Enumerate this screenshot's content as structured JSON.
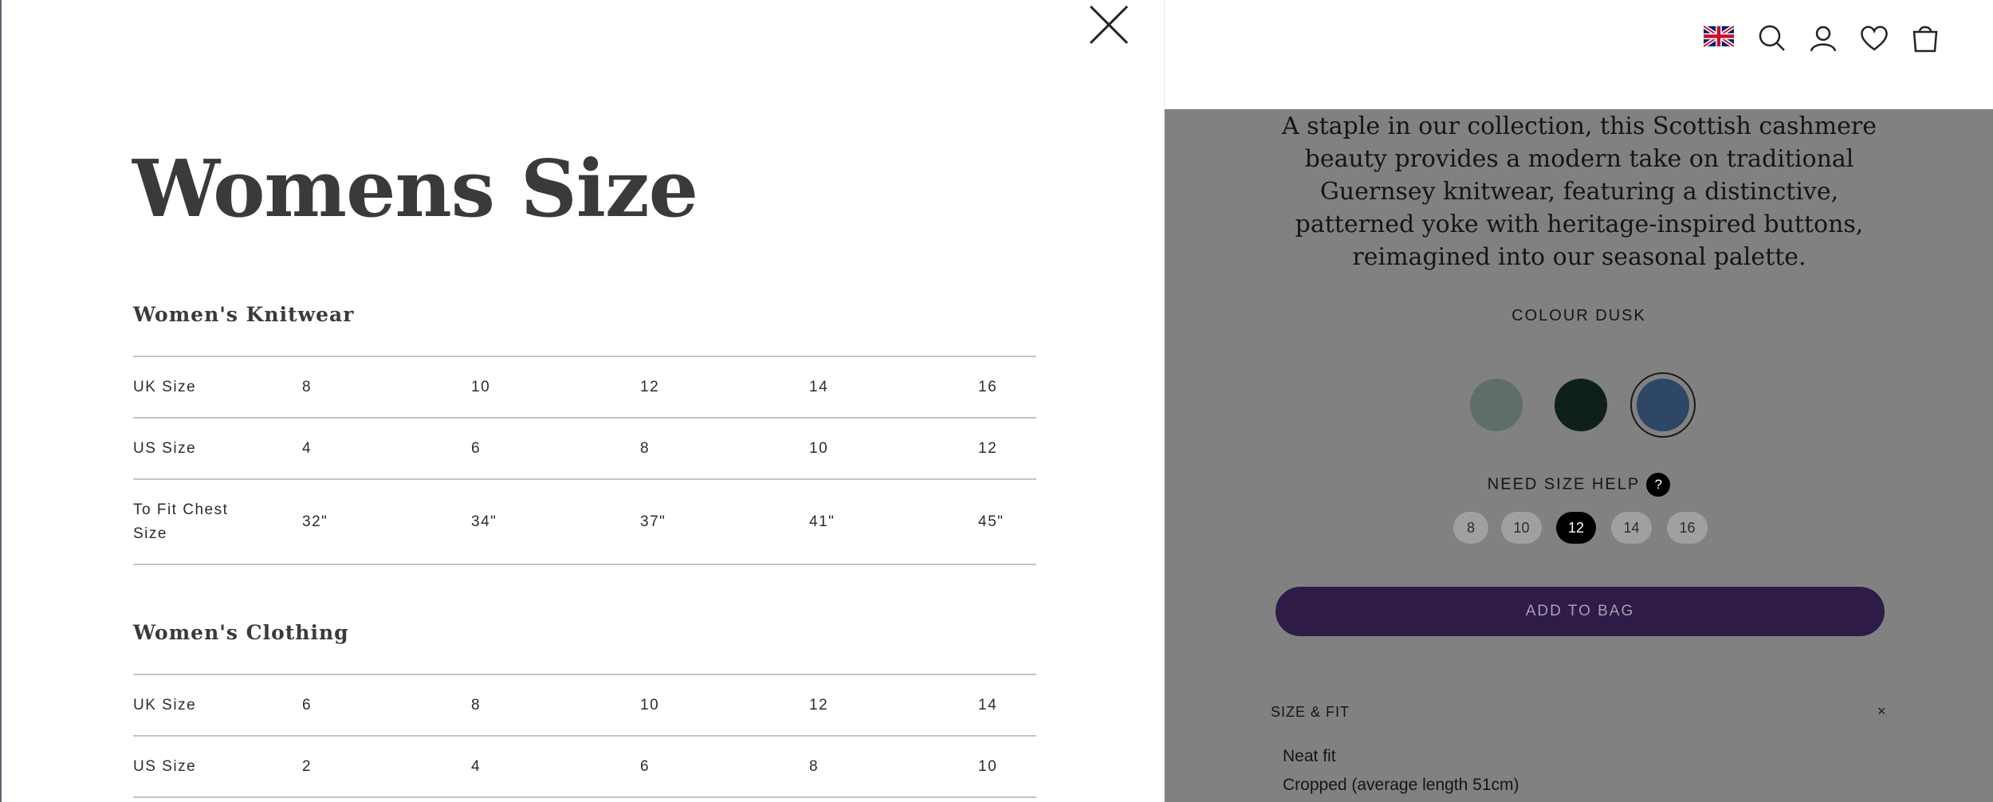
{
  "modal": {
    "title": "Womens Size",
    "close_icon": "close-x-icon",
    "sections": [
      {
        "title": "Women's Knitwear",
        "rows": [
          {
            "label": "UK Size",
            "values": [
              "8",
              "10",
              "12",
              "14",
              "16"
            ]
          },
          {
            "label": "US Size",
            "values": [
              "4",
              "6",
              "8",
              "10",
              "12"
            ]
          },
          {
            "label": "To Fit Chest Size",
            "values": [
              "32\"",
              "34\"",
              "37\"",
              "41\"",
              "45\""
            ]
          }
        ]
      },
      {
        "title": "Women's Clothing",
        "rows": [
          {
            "label": "UK Size",
            "values": [
              "6",
              "8",
              "10",
              "12",
              "14"
            ]
          },
          {
            "label": "US Size",
            "values": [
              "2",
              "4",
              "6",
              "8",
              "10"
            ]
          }
        ]
      }
    ]
  },
  "header": {
    "icons": [
      "uk-flag-icon",
      "search-icon",
      "account-icon",
      "wishlist-heart-icon",
      "shopping-bag-icon"
    ]
  },
  "product": {
    "description": "A staple in our collection, this Scottish cashmere beauty provides a modern take on traditional Guernsey knitwear, featuring a distinctive, patterned yoke with heritage-inspired buttons, reimagined into our seasonal palette.",
    "colour_label": "COLOUR DUSK",
    "swatches": [
      {
        "name": "sage",
        "color": "#5f6f67",
        "selected": false
      },
      {
        "name": "dark-green",
        "color": "#0e1f1c",
        "selected": false
      },
      {
        "name": "dusk",
        "color": "#2f4766",
        "selected": true
      }
    ],
    "size_help_label": "NEED SIZE HELP",
    "size_help_icon": "?",
    "sizes": [
      {
        "label": "8",
        "active": false
      },
      {
        "label": "10",
        "active": false
      },
      {
        "label": "12",
        "active": true
      },
      {
        "label": "14",
        "active": false
      },
      {
        "label": "16",
        "active": false
      }
    ],
    "add_to_bag": "ADD TO BAG",
    "size_fit": {
      "title": "SIZE & FIT",
      "toggle": "×",
      "lines": [
        "Neat fit",
        "Cropped (average length 51cm)"
      ]
    }
  },
  "colors": {
    "overlay": "#818181",
    "button": "#2e1b48",
    "text": "#2b2b2b"
  }
}
